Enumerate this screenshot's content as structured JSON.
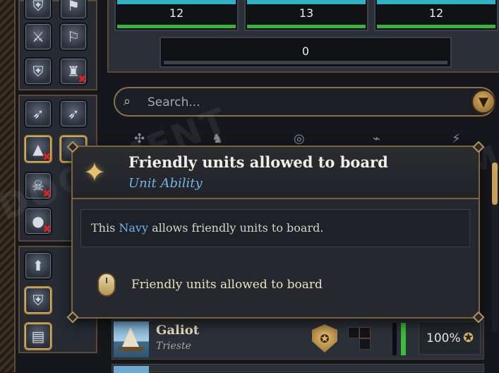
{
  "stats": {
    "values": [
      "12",
      "13",
      "12"
    ],
    "total": "0"
  },
  "search": {
    "placeholder": "Search...",
    "icon": "search-list-icon",
    "filter_icon": "funnel-icon"
  },
  "left_column": {
    "abilities": [
      {
        "icon": "shield-arrow-icon"
      },
      {
        "icon": "flag-arrow-icon"
      },
      {
        "icon": "shield-swords-icon"
      },
      {
        "icon": "flag-icon"
      },
      {
        "icon": "shield-star-icon"
      },
      {
        "icon": "soldier-cancel-icon"
      },
      {
        "icon": "cannon-icon"
      },
      {
        "icon": "cannon-alt-icon"
      },
      {
        "icon": "tent-icon"
      },
      {
        "icon": "compass-icon"
      },
      {
        "icon": "pirate-cancel-icon"
      },
      {
        "icon": "apple-cancel-icon"
      },
      {
        "icon": "arrow-up-icon"
      },
      {
        "icon": "shield-crossed-icon"
      },
      {
        "icon": "chest-icon"
      }
    ]
  },
  "tooltip": {
    "title": "Friendly units allowed to board",
    "subtitle": "Unit Ability",
    "desc_prefix": "This ",
    "desc_highlight": "Navy",
    "desc_suffix": " allows friendly units to board.",
    "action_label": "Friendly units allowed to board",
    "action_icon": "mouse-icon",
    "title_icon": "compass-star-icon"
  },
  "unit": {
    "name": "Galiot",
    "location": "Trieste",
    "health_percent": "100%",
    "health_fraction": 1.0,
    "badge_icon": "crest-badge-icon",
    "percent_icon": "recruit-icon"
  },
  "watermark": {
    "line1": "DOCUMENT",
    "line2": "IN DEVELOPMENT"
  },
  "colors": {
    "accent_gold": "#c7a25a",
    "link_blue": "#6eb6e8",
    "health_green": "#3bbd38",
    "stat_cyan": "#2fb3c4"
  }
}
